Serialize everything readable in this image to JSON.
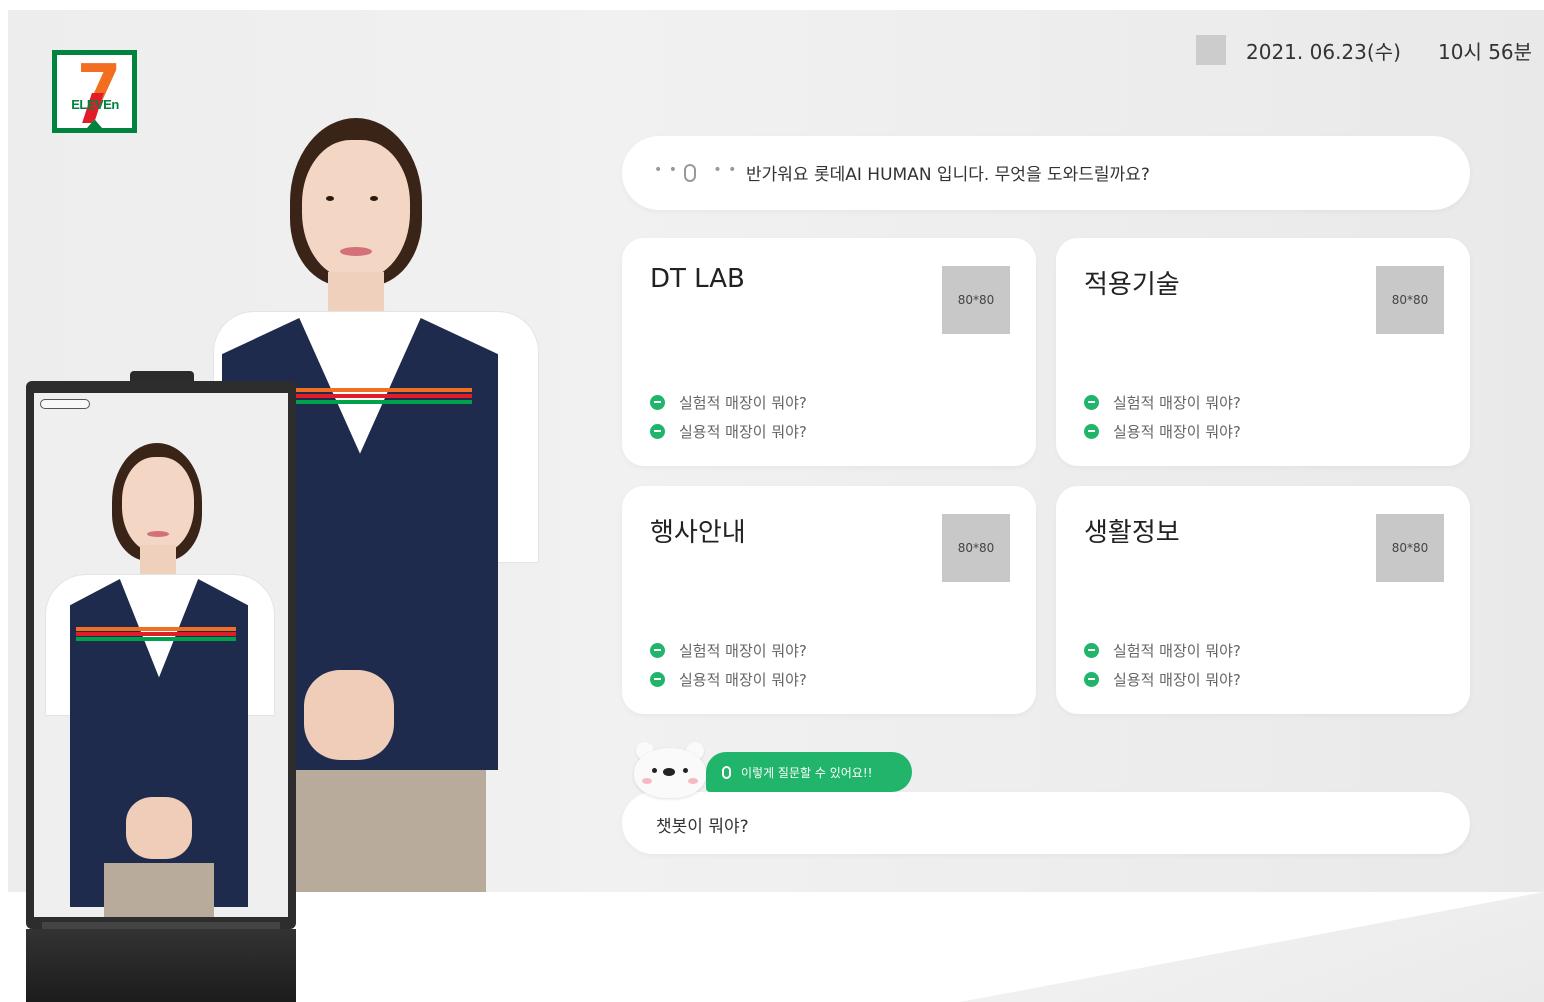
{
  "brand": {
    "logo_text": "ELEVEn",
    "logo_number": "7"
  },
  "header": {
    "date": "2021. 06.23(수)",
    "time": "10시 56분"
  },
  "greeting": {
    "dots_left": "• •",
    "dots_right": "• •",
    "text": "반가워요 롯데AI HUMAN 입니다. 무엇을 도와드릴까요?"
  },
  "cards": [
    {
      "title": "DT LAB",
      "image_label": "80*80",
      "questions": [
        "실험적 매장이 뭐야?",
        "실용적 매장이 뭐야?"
      ]
    },
    {
      "title": "적용기술",
      "image_label": "80*80",
      "questions": [
        "실험적 매장이 뭐야?",
        "실용적 매장이 뭐야?"
      ]
    },
    {
      "title": "행사안내",
      "image_label": "80*80",
      "questions": [
        "실험적 매장이 뭐야?",
        "실용적 매장이 뭐야?"
      ]
    },
    {
      "title": "생활정보",
      "image_label": "80*80",
      "questions": [
        "실험적 매장이 뭐야?",
        "실용적 매장이 뭐야?"
      ]
    }
  ],
  "chat": {
    "hint": "이렇게 질문할 수 있어요!!",
    "input_value": "챗봇이 뭐야?"
  },
  "colors": {
    "accent_green": "#20b56b",
    "logo_green": "#00833e",
    "logo_orange": "#f26f21",
    "logo_red": "#e11d2a",
    "vest_navy": "#1e2b4d"
  },
  "icons": [
    "seven-eleven-logo",
    "microphone-icon",
    "bullet-chat-icon",
    "polar-bear-mascot"
  ]
}
